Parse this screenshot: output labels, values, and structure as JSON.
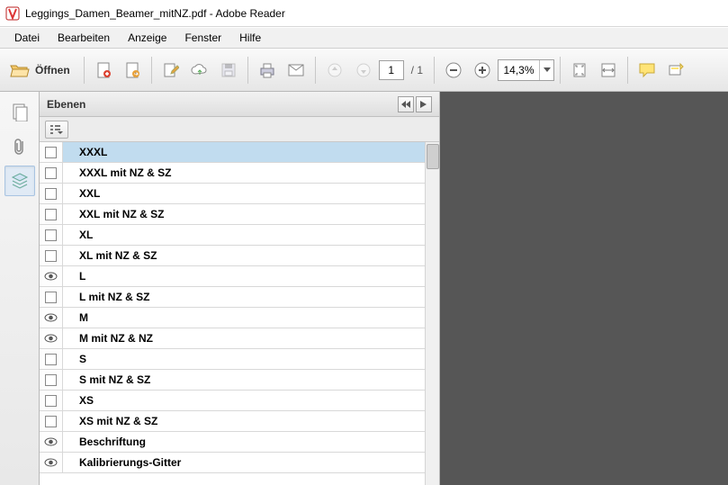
{
  "title": "Leggings_Damen_Beamer_mitNZ.pdf - Adobe Reader",
  "menu": [
    "Datei",
    "Bearbeiten",
    "Anzeige",
    "Fenster",
    "Hilfe"
  ],
  "toolbar": {
    "open_label": "Öffnen",
    "page_current": "1",
    "page_total": "/ 1",
    "zoom_value": "14,3%"
  },
  "panel": {
    "title": "Ebenen"
  },
  "layers": [
    {
      "label": "XXXL",
      "visible": false,
      "selected": true
    },
    {
      "label": "XXXL mit NZ & SZ",
      "visible": false,
      "selected": false
    },
    {
      "label": "XXL",
      "visible": false,
      "selected": false
    },
    {
      "label": "XXL mit NZ & SZ",
      "visible": false,
      "selected": false
    },
    {
      "label": "XL",
      "visible": false,
      "selected": false
    },
    {
      "label": "XL mit NZ & SZ",
      "visible": false,
      "selected": false
    },
    {
      "label": "L",
      "visible": true,
      "selected": false
    },
    {
      "label": "L mit NZ & SZ",
      "visible": false,
      "selected": false
    },
    {
      "label": "M",
      "visible": true,
      "selected": false
    },
    {
      "label": "M mit NZ & NZ",
      "visible": true,
      "selected": false
    },
    {
      "label": "S",
      "visible": false,
      "selected": false
    },
    {
      "label": "S mit NZ & SZ",
      "visible": false,
      "selected": false
    },
    {
      "label": "XS",
      "visible": false,
      "selected": false
    },
    {
      "label": "XS mit NZ & SZ",
      "visible": false,
      "selected": false
    },
    {
      "label": "Beschriftung",
      "visible": true,
      "selected": false
    },
    {
      "label": "Kalibrierungs-Gitter",
      "visible": true,
      "selected": false
    }
  ]
}
